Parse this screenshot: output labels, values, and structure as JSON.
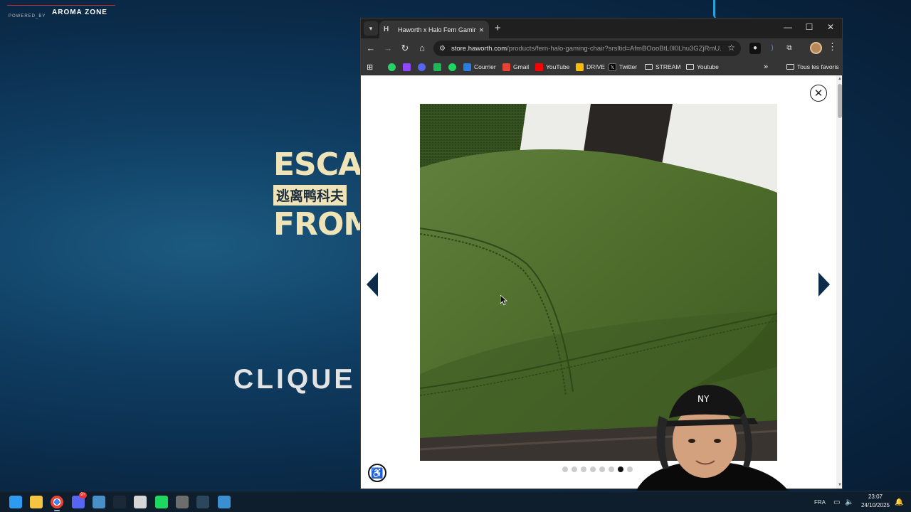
{
  "background": {
    "sponsor_small": "POWERED_BY",
    "sponsor_brand": "AROMA ZONE",
    "game_title_line1": "ESCAPE",
    "game_title_line2": "逃离鸭科夫",
    "game_title_line3": "FROM",
    "click_text": "CLIQUE"
  },
  "browser": {
    "tab": {
      "favicon": "H",
      "title": "Haworth x Halo Fern Gaming C",
      "close": "×"
    },
    "new_tab": "+",
    "window_controls": {
      "minimize": "—",
      "maximize": "☐",
      "close": "✕"
    },
    "nav": {
      "back": "←",
      "forward": "→",
      "reload": "↻",
      "home": "⌂"
    },
    "url_host": "store.haworth.com",
    "url_path": "/products/fern-halo-gaming-chair?srsltid=AfmBOooBtL0l0Lhu3GZjRmU...",
    "bookmarks": [
      {
        "label": "",
        "icon": "apps-grid-icon"
      },
      {
        "label": "",
        "icon": "whatsapp-icon",
        "color": "#25d366"
      },
      {
        "label": "",
        "icon": "twitch-icon",
        "color": "#9146ff"
      },
      {
        "label": "",
        "icon": "discord-icon",
        "color": "#5865f2"
      },
      {
        "label": "",
        "icon": "green-app-icon",
        "color": "#1db954"
      },
      {
        "label": "",
        "icon": "spotify-icon",
        "color": "#1ed760"
      },
      {
        "label": "Courrier",
        "icon": "mail-icon",
        "color": "#2a7de1"
      },
      {
        "label": "Gmail",
        "icon": "gmail-icon",
        "color": "#ea4335"
      },
      {
        "label": "YouTube",
        "icon": "youtube-icon",
        "color": "#ff0000"
      },
      {
        "label": "DRIVE",
        "icon": "drive-icon",
        "color": "#fbbc04"
      },
      {
        "label": "Twitter",
        "icon": "x-icon",
        "color": "#000000"
      },
      {
        "label": "STREAM",
        "icon": "folder-icon"
      },
      {
        "label": "Youtube",
        "icon": "folder-icon"
      }
    ],
    "overflow": "»",
    "all_bookmarks": "Tous les favoris"
  },
  "page": {
    "close_label": "✕",
    "image_count": 8,
    "active_image_index": 6,
    "accessibility_label": "♿"
  },
  "taskbar": {
    "apps": [
      {
        "name": "windows-start-icon",
        "color": "#2d9cf0"
      },
      {
        "name": "file-explorer-icon",
        "color": "#f5c542"
      },
      {
        "name": "chrome-icon",
        "color": "#e94335"
      },
      {
        "name": "discord-icon",
        "color": "#5865f2"
      },
      {
        "name": "calculator-icon",
        "color": "#4a90c8"
      },
      {
        "name": "steam-icon",
        "color": "#1b2838"
      },
      {
        "name": "notepad-icon",
        "color": "#d6d6d6"
      },
      {
        "name": "spotify-icon",
        "color": "#1ed760"
      },
      {
        "name": "obs-icon",
        "color": "#6d6d6d"
      },
      {
        "name": "steam-icon-2",
        "color": "#2a475e"
      },
      {
        "name": "game-icon",
        "color": "#3a8fd0"
      }
    ],
    "discord_badge": "9+",
    "language": "FRA",
    "time": "23:07",
    "date": "24/10/2025"
  }
}
